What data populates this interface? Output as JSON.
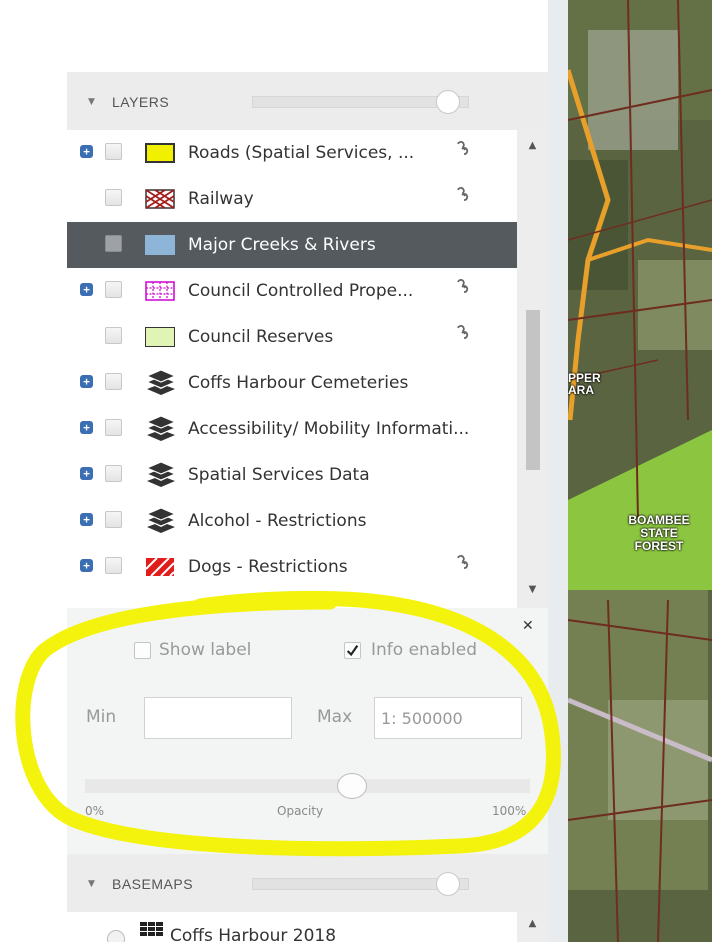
{
  "layers_panel": {
    "title": "LAYERS",
    "opacity_fraction": 0.9,
    "items": [
      {
        "name": "Roads (Spatial Services, ...",
        "expandable": true,
        "icon": "swatch-yellow",
        "link": true
      },
      {
        "name": "Railway",
        "expandable": false,
        "icon": "swatch-railway",
        "link": true
      },
      {
        "name": "Major Creeks & Rivers",
        "expandable": false,
        "icon": "swatch-blue",
        "link": false,
        "selected": true
      },
      {
        "name": "Council Controlled Prope...",
        "expandable": true,
        "icon": "swatch-grid-magenta",
        "link": true
      },
      {
        "name": "Council Reserves",
        "expandable": false,
        "icon": "swatch-lightgreen",
        "link": true
      },
      {
        "name": "Coffs Harbour Cemeteries",
        "expandable": true,
        "icon": "layers-stack-icon",
        "link": false
      },
      {
        "name": "Accessibility/ Mobility Informati...",
        "expandable": true,
        "icon": "layers-stack-icon",
        "link": false
      },
      {
        "name": "Spatial Services Data",
        "expandable": true,
        "icon": "layers-stack-icon",
        "link": false
      },
      {
        "name": "Alcohol - Restrictions",
        "expandable": true,
        "icon": "layers-stack-icon",
        "link": false
      },
      {
        "name": "Dogs - Restrictions",
        "expandable": true,
        "icon": "swatch-red-hatch",
        "link": true
      }
    ]
  },
  "layer_properties": {
    "show_label": {
      "label": "Show label",
      "checked": false
    },
    "info_enabled": {
      "label": "Info enabled",
      "checked": true
    },
    "min_label": "Min",
    "min_value": "",
    "max_label": "Max",
    "max_value": "1: 500000",
    "opacity": {
      "min_label": "0%",
      "label": "Opacity",
      "max_label": "100%",
      "value_fraction": 0.6
    }
  },
  "basemaps_panel": {
    "title": "BASEMAPS",
    "opacity_fraction": 0.9,
    "items": [
      {
        "name": "Coffs Harbour 2018"
      }
    ]
  },
  "map": {
    "labels": [
      "PPER",
      "ARA",
      "BOAMBEE",
      "STATE",
      "FOREST"
    ]
  },
  "colors": {
    "highlight": "#f2f200",
    "selected_row": "#555a5f",
    "forest": "#8cc640",
    "road": "#e8a02a"
  }
}
